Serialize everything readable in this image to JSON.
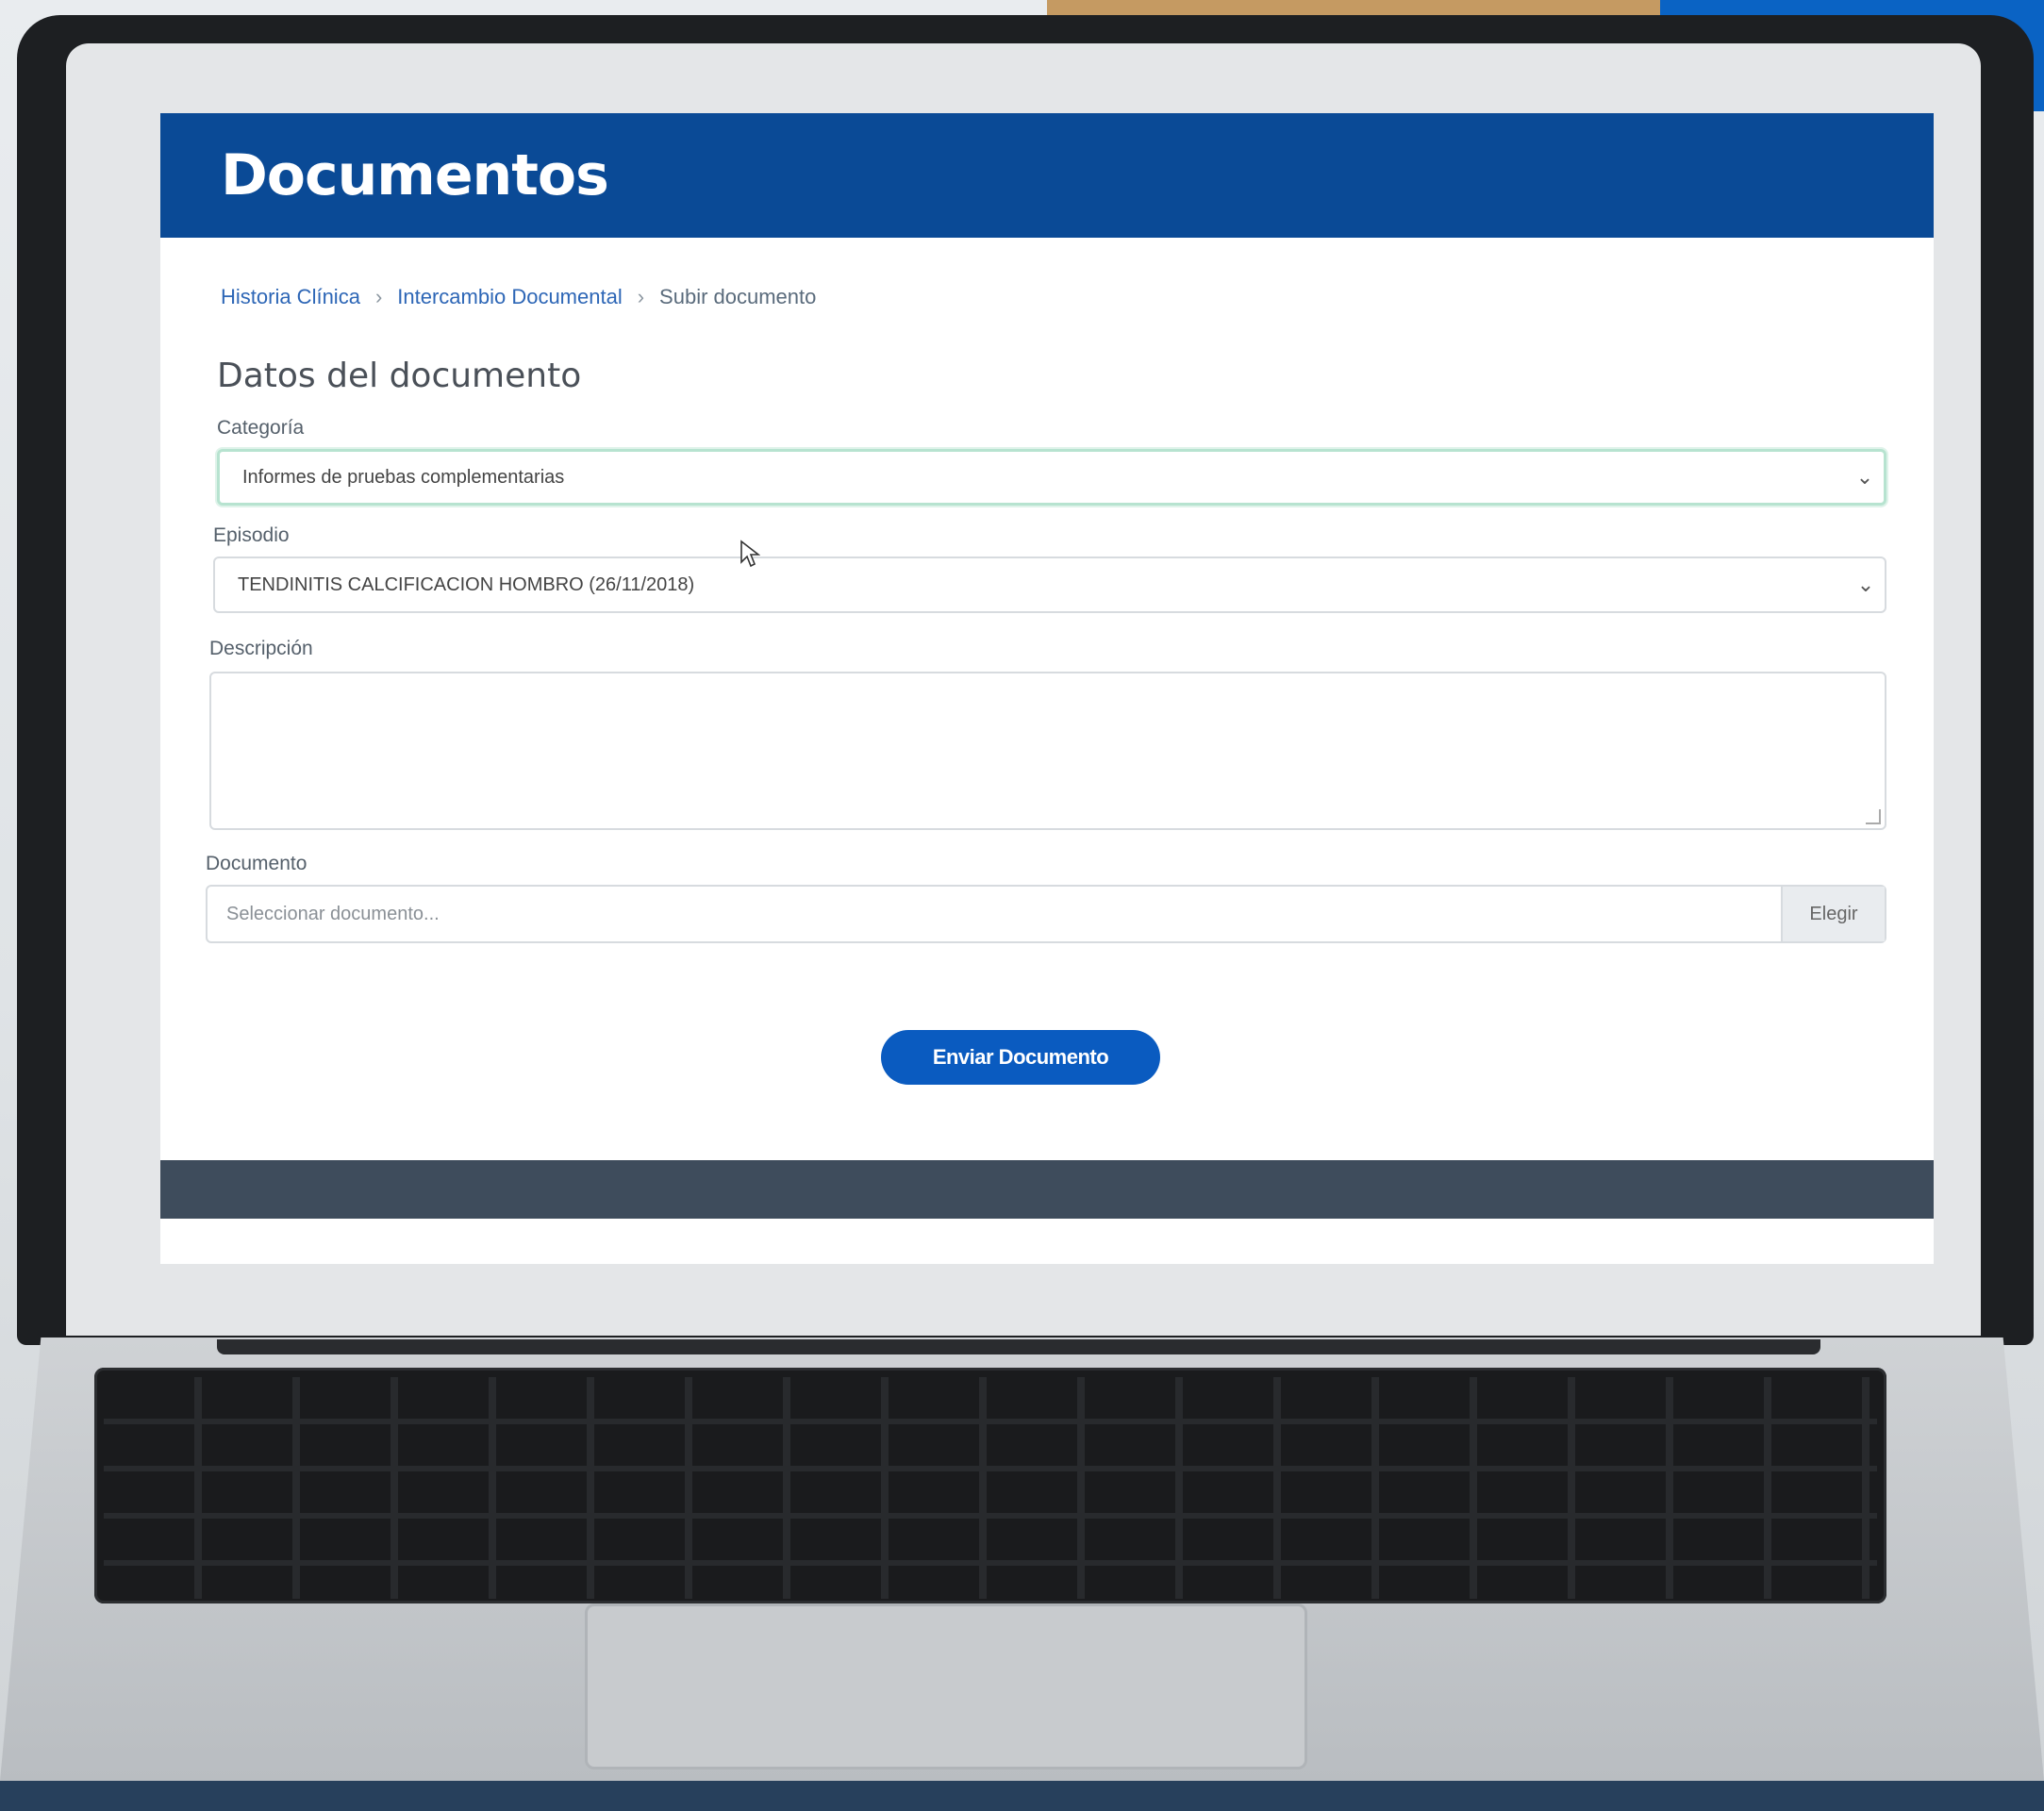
{
  "header": {
    "title": "Documentos"
  },
  "breadcrumb": {
    "items": [
      "Historia Clínica",
      "Intercambio Documental",
      "Subir documento"
    ],
    "separator": "›"
  },
  "form": {
    "section_title": "Datos del documento",
    "categoria": {
      "label": "Categoría",
      "value": "Informes de pruebas complementarias"
    },
    "episodio": {
      "label": "Episodio",
      "value": "TENDINITIS CALCIFICACION HOMBRO (26/11/2018)"
    },
    "descripcion": {
      "label": "Descripción",
      "value": ""
    },
    "documento": {
      "label": "Documento",
      "placeholder": "Seleccionar documento...",
      "browse_label": "Elegir"
    },
    "submit_label": "Enviar Documento"
  },
  "colors": {
    "header_bg": "#0a4a96",
    "accent": "#0a5bc0",
    "footer_bg": "#3e4c5c"
  },
  "icons": {
    "select_arrow": "chevron-down-icon",
    "cursor": "mouse-pointer-icon"
  }
}
